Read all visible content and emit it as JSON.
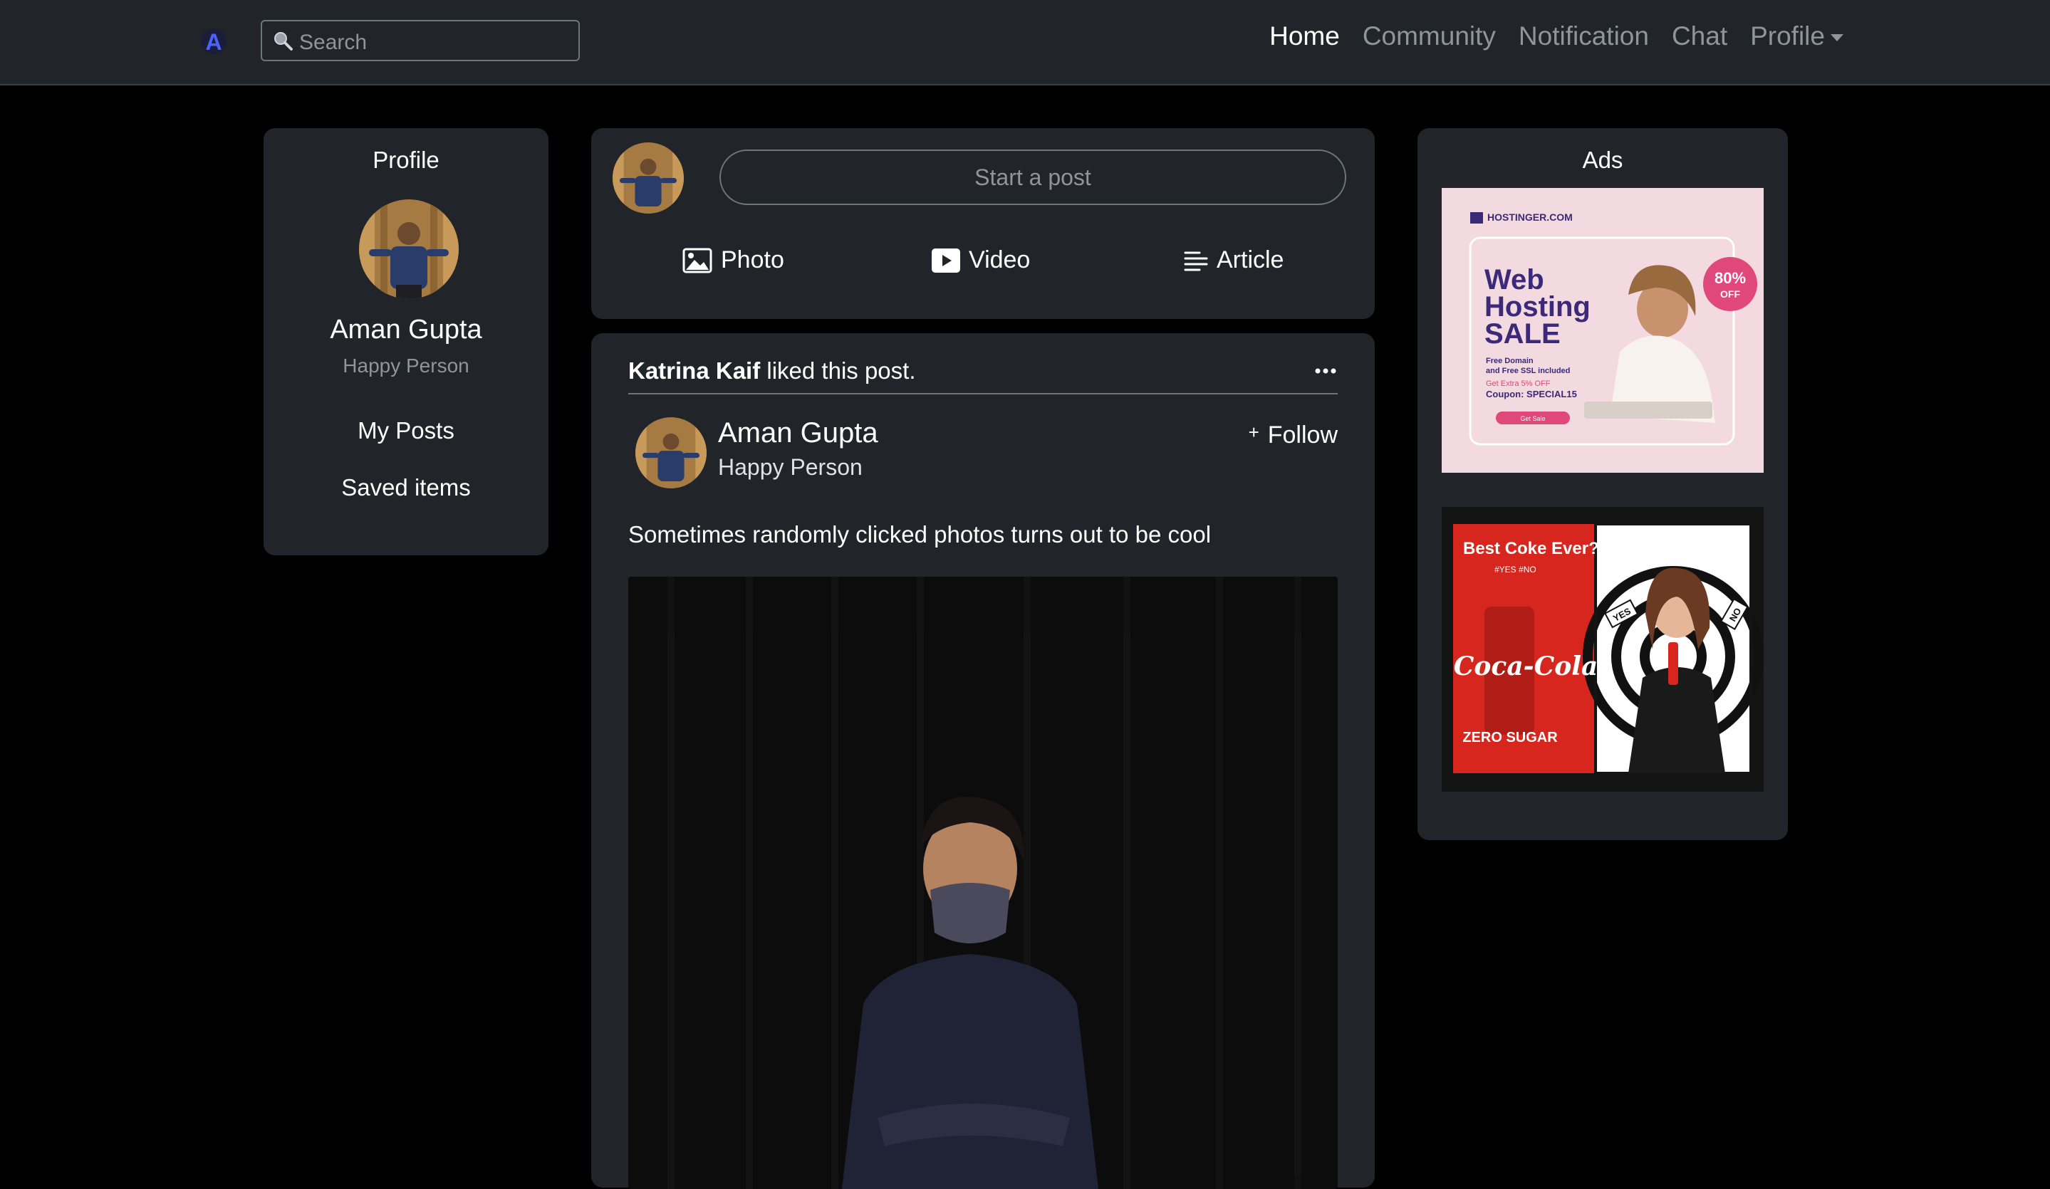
{
  "navbar": {
    "logo_letter": "A",
    "search_placeholder": "Search",
    "links": [
      "Home",
      "Community",
      "Notification",
      "Chat",
      "Profile"
    ]
  },
  "profile_card": {
    "title": "Profile",
    "name": "Aman Gupta",
    "tagline": "Happy Person",
    "links": [
      "My Posts",
      "Saved items"
    ]
  },
  "composer": {
    "placeholder": "Start a post",
    "actions": [
      "Photo",
      "Video",
      "Article"
    ]
  },
  "post": {
    "liker": "Katrina Kaif",
    "liked_text": " liked this post.",
    "author": "Aman Gupta",
    "author_tagline": "Happy Person",
    "follow_label": "Follow",
    "caption": "Sometimes randomly clicked photos turns out to be cool"
  },
  "ads": {
    "title": "Ads",
    "ad1": {
      "brand": "HOSTINGER.COM",
      "headline": [
        "Web",
        "Hosting",
        "SALE"
      ],
      "badge_pct": "80%",
      "badge_off": "OFF",
      "line1": "Free Domain",
      "line2": "and Free SSL included",
      "line3": "Get Extra 5% OFF",
      "coupon": "Coupon: SPECIAL15",
      "cta": "Get Sale"
    },
    "ad2": {
      "headline": "Best Coke Ever?",
      "sub": "#YES #NO",
      "brand": "Coca-Cola",
      "variant": "ZERO SUGAR",
      "yes": "YES",
      "no": "NO"
    }
  },
  "colors": {
    "navbar": "#212529",
    "card": "#212529",
    "muted": "#8e959b",
    "background": "#000000"
  }
}
